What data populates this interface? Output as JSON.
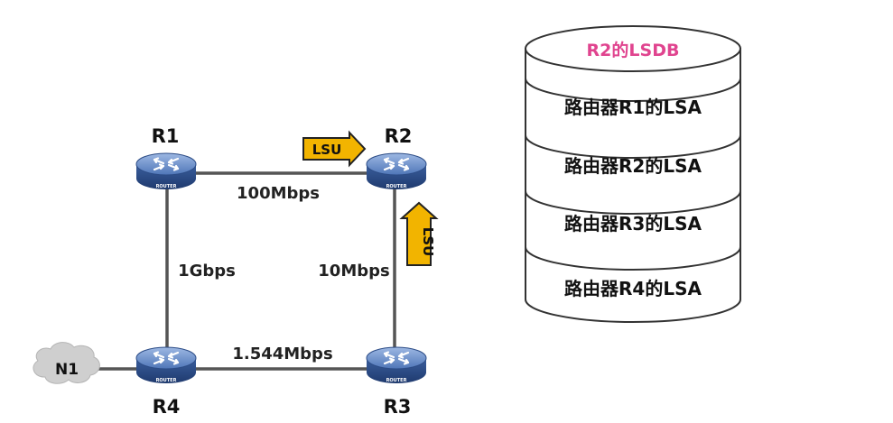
{
  "routers": {
    "r1": {
      "name": "R1",
      "sub": "ROUTER"
    },
    "r2": {
      "name": "R2",
      "sub": "ROUTER"
    },
    "r3": {
      "name": "R3",
      "sub": "ROUTER"
    },
    "r4": {
      "name": "R4",
      "sub": "ROUTER"
    }
  },
  "links": {
    "r1_r2": "100Mbps",
    "r1_r4": "1Gbps",
    "r2_r3": "10Mbps",
    "r4_r3": "1.544Mbps"
  },
  "network": {
    "n1": "N1"
  },
  "lsu": {
    "top": "LSU",
    "right": "LSU"
  },
  "lsdb": {
    "title": "R2的LSDB",
    "entries": [
      "路由器R1的LSA",
      "路由器R2的LSA",
      "路由器R3的LSA",
      "路由器R4的LSA"
    ]
  },
  "colors": {
    "router_body": "#2f4f8f",
    "router_top": "#6f95cf",
    "link": "#555555",
    "lsu_fill": "#f2b400",
    "lsdb_title": "#e0448f",
    "cloud": "#c9c9c9"
  }
}
